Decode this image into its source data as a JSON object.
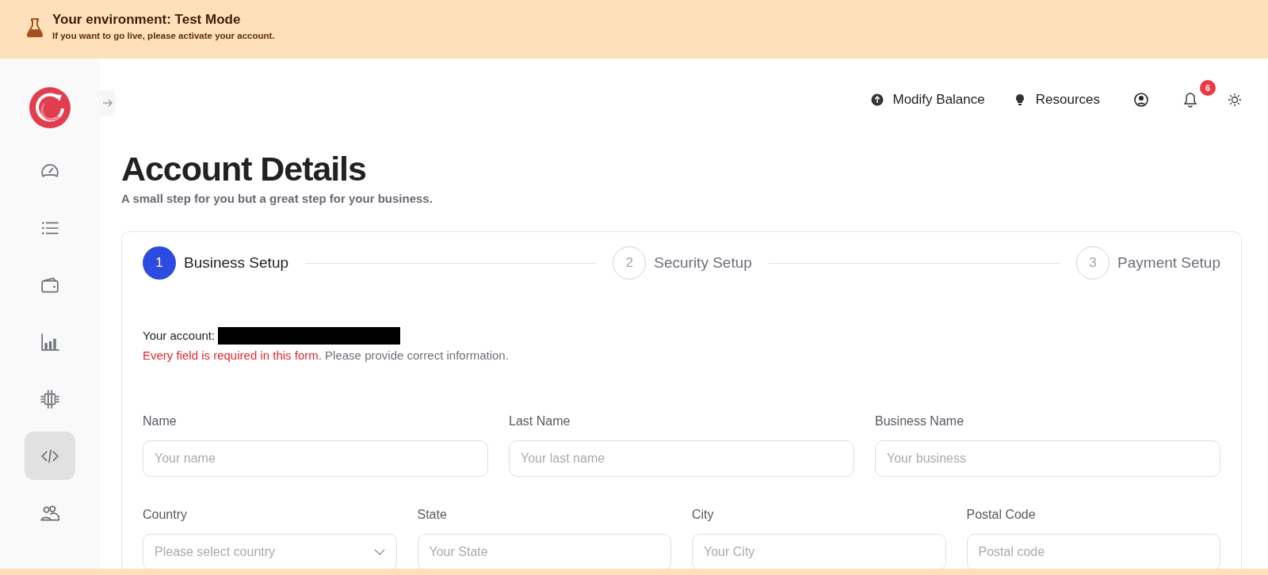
{
  "banner": {
    "title": "Your environment: Test Mode",
    "subtitle": "If you want to go live, please activate your account."
  },
  "sidebar": {
    "items": [
      {
        "kind": "gauge",
        "selected": false
      },
      {
        "kind": "list",
        "selected": false
      },
      {
        "kind": "wallet",
        "selected": false
      },
      {
        "kind": "chart",
        "selected": false
      },
      {
        "kind": "chip",
        "selected": false
      },
      {
        "kind": "code",
        "selected": true
      },
      {
        "kind": "users",
        "selected": false
      }
    ]
  },
  "top_nav": {
    "links": [
      {
        "kind": "balance",
        "label": "Modify Balance"
      },
      {
        "kind": "resources",
        "label": "Resources"
      }
    ],
    "notifications_count": "6"
  },
  "page": {
    "title": "Account Details",
    "subtitle": "A small step for you but a great step for your business."
  },
  "steps": [
    {
      "number": "1",
      "label": "Business Setup",
      "selected": true
    },
    {
      "number": "2",
      "label": "Security Setup",
      "selected": false
    },
    {
      "number": "3",
      "label": "Payment Setup",
      "selected": false
    }
  ],
  "form": {
    "account_label": "Your account:",
    "required_note": "Every field is required in this form.",
    "hint": "Please provide correct information.",
    "rows": [
      [
        {
          "kind": "text",
          "label": "Name",
          "placeholder": "Your name"
        },
        {
          "kind": "text",
          "label": "Last Name",
          "placeholder": "Your last name"
        },
        {
          "kind": "text",
          "label": "Business Name",
          "placeholder": "Your business"
        }
      ],
      [
        {
          "kind": "select",
          "label": "Country",
          "placeholder": "Please select country"
        },
        {
          "kind": "text",
          "label": "State",
          "placeholder": "Your State"
        },
        {
          "kind": "text",
          "label": "City",
          "placeholder": "Your City"
        },
        {
          "kind": "text",
          "label": "Postal Code",
          "placeholder": "Postal code"
        }
      ]
    ]
  }
}
